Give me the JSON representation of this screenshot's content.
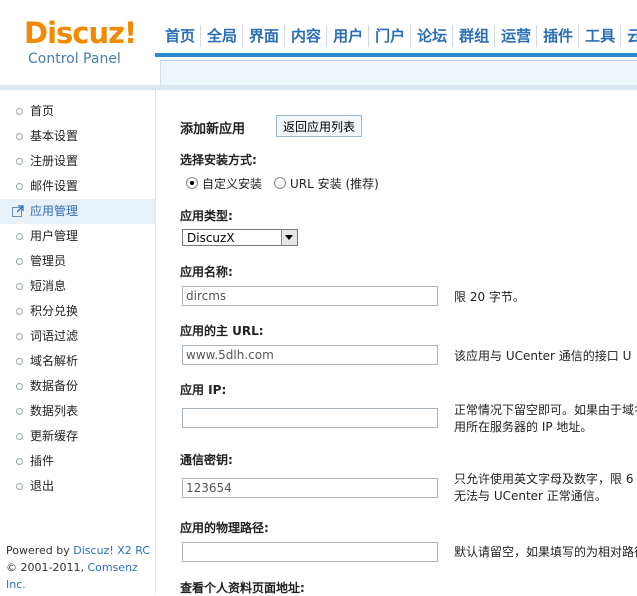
{
  "header": {
    "logo": "Discuz!",
    "subtitle": "Control Panel",
    "tabs": [
      "首页",
      "全局",
      "界面",
      "内容",
      "用户",
      "门户",
      "论坛",
      "群组",
      "运营",
      "插件",
      "工具",
      "云平台"
    ]
  },
  "sidebar": {
    "items": [
      {
        "label": "首页"
      },
      {
        "label": "基本设置"
      },
      {
        "label": "注册设置"
      },
      {
        "label": "邮件设置"
      },
      {
        "label": "应用管理"
      },
      {
        "label": "用户管理"
      },
      {
        "label": "管理员"
      },
      {
        "label": "短消息"
      },
      {
        "label": "积分兑换"
      },
      {
        "label": "词语过滤"
      },
      {
        "label": "域名解析"
      },
      {
        "label": "数据备份"
      },
      {
        "label": "数据列表"
      },
      {
        "label": "更新缓存"
      },
      {
        "label": "插件"
      },
      {
        "label": "退出"
      }
    ],
    "active_index": 4,
    "footer_line1_prefix": "Powered by ",
    "footer_line1_link": "Discuz! X2 RC",
    "footer_line2_prefix": "© 2001-2011, ",
    "footer_line2_link": "Comsenz Inc."
  },
  "main": {
    "title": "添加新应用",
    "back_button": "返回应用列表",
    "install_label": "选择安装方式:",
    "option_custom": "自定义安装",
    "option_url": "URL 安装 (推荐)",
    "type_label": "应用类型:",
    "type_value": "DiscuzX",
    "name_label": "应用名称:",
    "name_value": "dircms",
    "name_hint": "限 20 字节。",
    "url_label": "应用的主 URL:",
    "url_value": "www.5dlh.com",
    "url_hint": "该应用与 UCenter 通信的接口 U",
    "ip_label": "应用 IP:",
    "ip_value": "",
    "ip_hint1": "正常情况下留空即可。如果由于域名",
    "ip_hint2": "用所在服务器的 IP 地址。",
    "key_label": "通信密钥:",
    "key_value": "123654",
    "key_hint1": "只允许使用英文字母及数字，限 6",
    "key_hint2": "无法与 UCenter 正常通信。",
    "path_label": "应用的物理路径:",
    "path_value": "",
    "path_hint": "默认请留空，如果填写的为相对路径",
    "profile_label": "查看个人资料页面地址:"
  },
  "colors": {
    "logo": "#f08a00",
    "nav": "#2b6fb6",
    "accent_line": "#2b8bd0"
  }
}
